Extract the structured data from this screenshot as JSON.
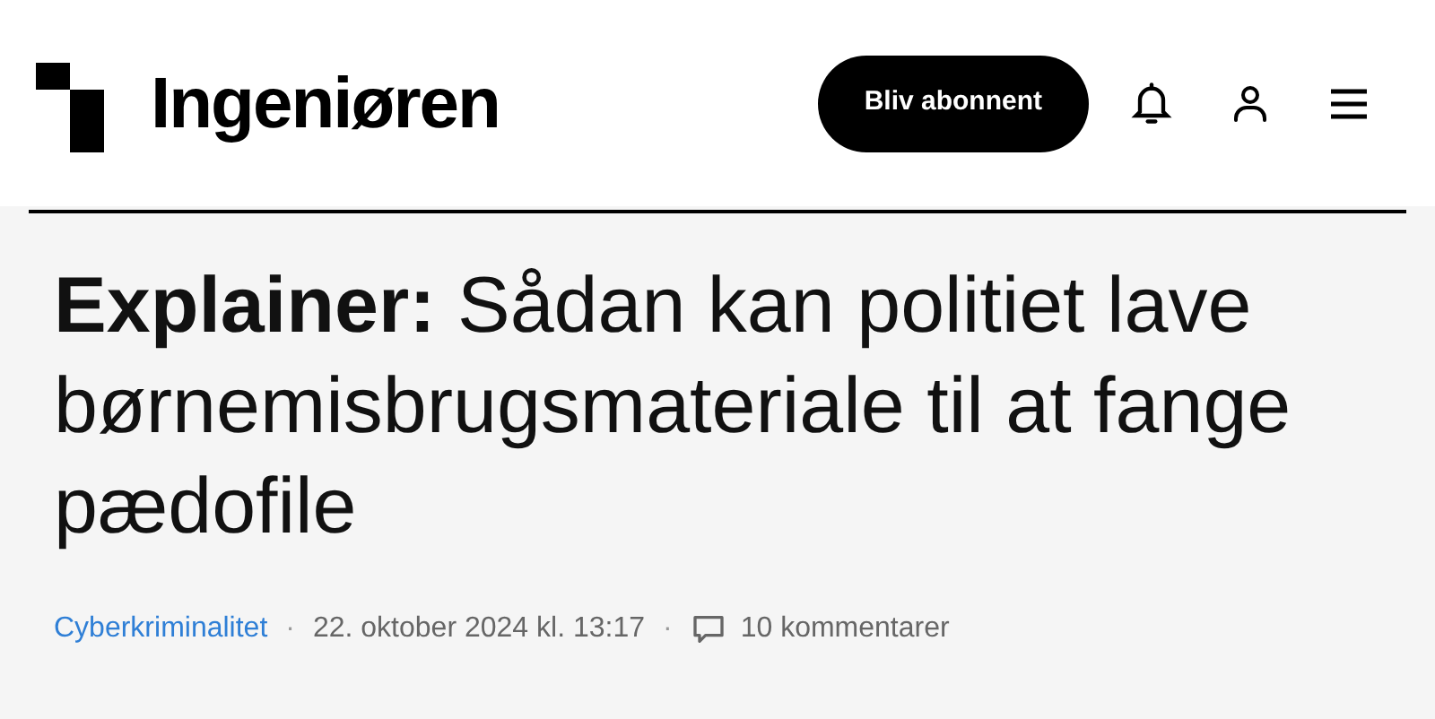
{
  "header": {
    "logo_text": "Ingeniøren",
    "subscribe_button": "Bliv abonnent"
  },
  "article": {
    "title": "**Explainer:** Sådan kan politiet lave børnemisbrugsmateriale til at fange pædofile",
    "meta": {
      "category": "Cyberkriminalitet",
      "separator": "·",
      "date": "22. oktober 2024 kl. 13:17",
      "comments": "10 kommentarer"
    }
  }
}
